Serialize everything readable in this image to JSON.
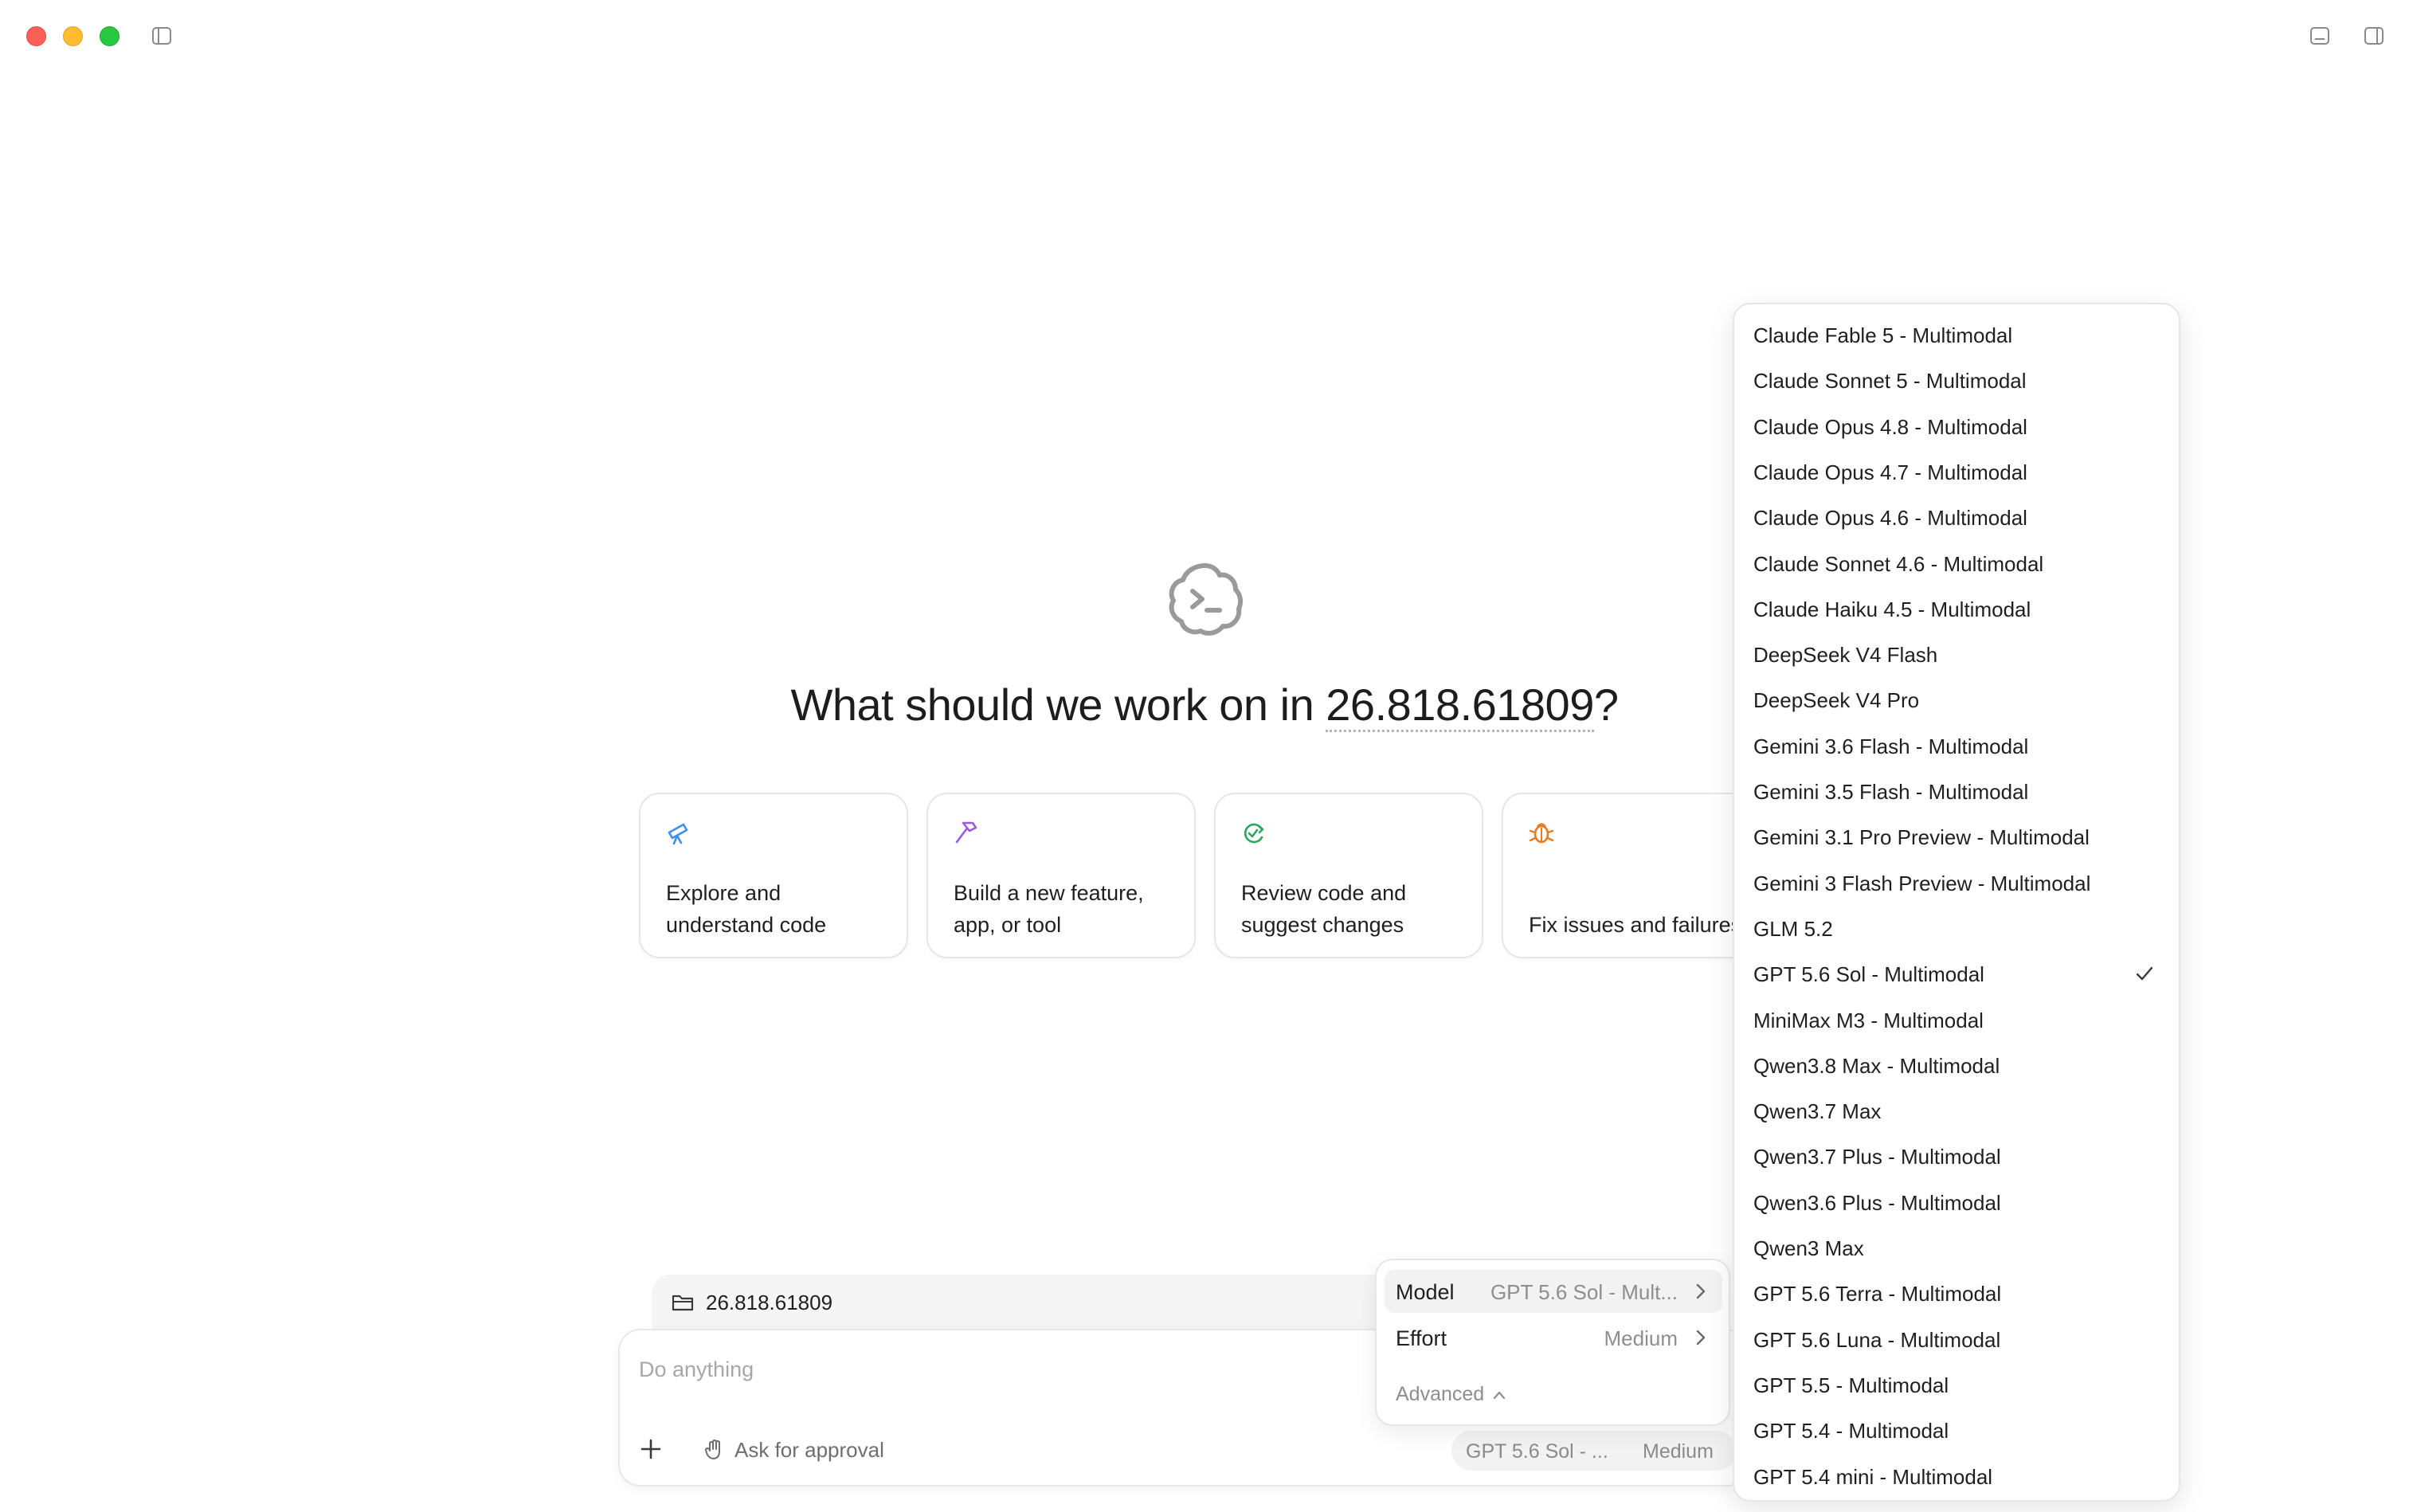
{
  "headline": {
    "prefix": "What should we work on in ",
    "folder": "26.818.61809",
    "suffix": "?"
  },
  "cards": [
    {
      "label": "Explore and\nunderstand code",
      "icon": "telescope-icon",
      "color": "#3b8ff5"
    },
    {
      "label": "Build a new feature,\napp, or tool",
      "icon": "hammer-icon",
      "color": "#9b59e6"
    },
    {
      "label": "Review code and\nsuggest changes",
      "icon": "review-icon",
      "color": "#2aa65a"
    },
    {
      "label": "Fix issues and failures",
      "icon": "bug-icon",
      "color": "#e8791f"
    }
  ],
  "composer": {
    "folder": "26.818.61809",
    "placeholder": "Do anything",
    "approval": "Ask for approval",
    "model_short": "GPT 5.6 Sol - ...",
    "effort_short": "Medium"
  },
  "settings": {
    "model_key": "Model",
    "model_value": "GPT 5.6 Sol - Mult...",
    "effort_key": "Effort",
    "effort_value": "Medium",
    "advanced": "Advanced"
  },
  "models": [
    "Claude Fable 5 - Multimodal",
    "Claude Sonnet 5 - Multimodal",
    "Claude Opus 4.8 - Multimodal",
    "Claude Opus 4.7 - Multimodal",
    "Claude Opus 4.6 - Multimodal",
    "Claude Sonnet 4.6 - Multimodal",
    "Claude Haiku 4.5 - Multimodal",
    "DeepSeek V4 Flash",
    "DeepSeek V4 Pro",
    "Gemini 3.6 Flash - Multimodal",
    "Gemini 3.5 Flash - Multimodal",
    "Gemini 3.1 Pro Preview - Multimodal",
    "Gemini 3 Flash Preview - Multimodal",
    "GLM 5.2",
    "GPT 5.6 Sol - Multimodal",
    "MiniMax M3 - Multimodal",
    "Qwen3.8 Max - Multimodal",
    "Qwen3.7 Max",
    "Qwen3.7 Plus - Multimodal",
    "Qwen3.6 Plus - Multimodal",
    "Qwen3 Max",
    "GPT 5.6 Terra - Multimodal",
    "GPT 5.6 Luna - Multimodal",
    "GPT 5.5 - Multimodal",
    "GPT 5.4 - Multimodal",
    "GPT 5.4 mini - Multimodal"
  ],
  "selected_model": "GPT 5.6 Sol - Multimodal"
}
